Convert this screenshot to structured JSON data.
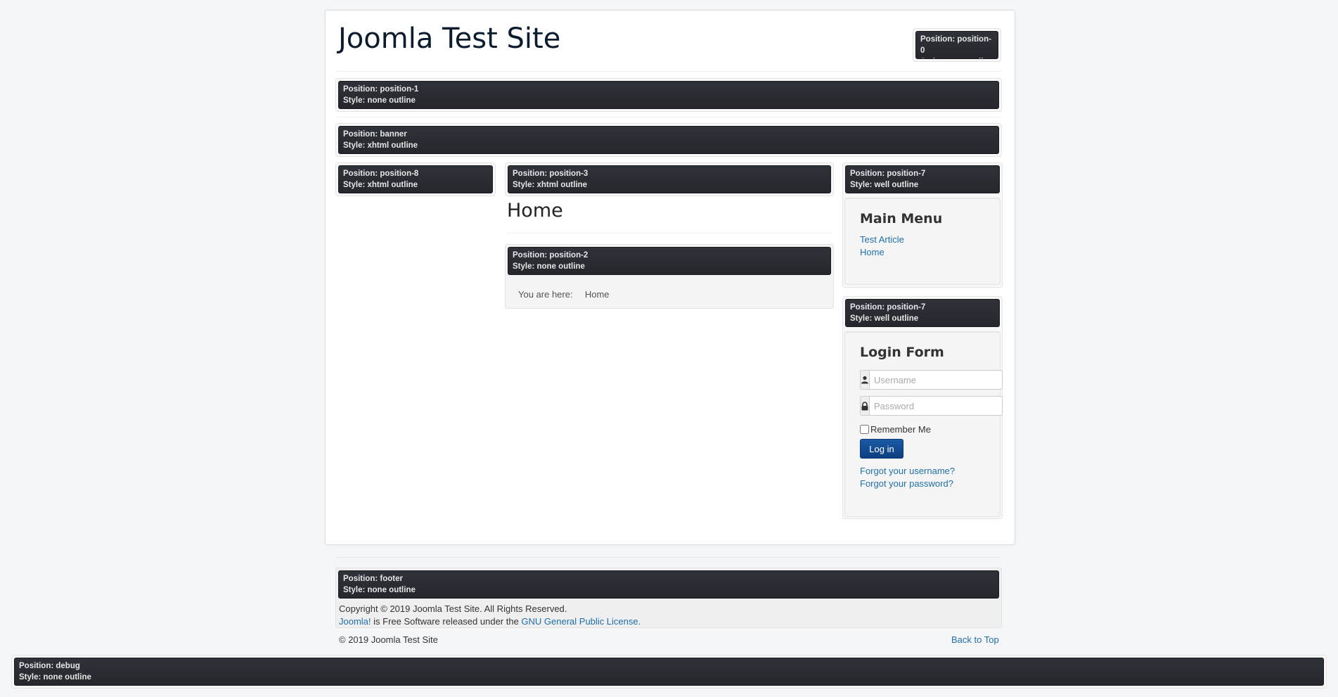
{
  "site": {
    "title": "Joomla Test Site"
  },
  "modules": {
    "position_0": {
      "position": "Position: position-0",
      "style": "Style: none outline"
    },
    "position_1": {
      "position": "Position: position-1",
      "style": "Style: none outline"
    },
    "banner": {
      "position": "Position: banner",
      "style": "Style: xhtml outline"
    },
    "position_8": {
      "position": "Position: position-8",
      "style": "Style: xhtml outline"
    },
    "position_3": {
      "position": "Position: position-3",
      "style": "Style: xhtml outline"
    },
    "position_2": {
      "position": "Position: position-2",
      "style": "Style: none outline"
    },
    "position_7a": {
      "position": "Position: position-7",
      "style": "Style: well outline"
    },
    "position_7b": {
      "position": "Position: position-7",
      "style": "Style: well outline"
    },
    "footer": {
      "position": "Position: footer",
      "style": "Style: none outline"
    },
    "debug": {
      "position": "Position: debug",
      "style": "Style: none outline"
    }
  },
  "main": {
    "page_heading": "Home",
    "breadcrumb": {
      "label": "You are here:",
      "current": "Home"
    }
  },
  "main_menu": {
    "title": "Main Menu",
    "items": [
      {
        "label": "Test Article"
      },
      {
        "label": "Home"
      }
    ]
  },
  "login_form": {
    "title": "Login Form",
    "username": {
      "placeholder": "Username",
      "value": ""
    },
    "password": {
      "placeholder": "Password",
      "value": ""
    },
    "remember_me": "Remember Me",
    "login_button": "Log in",
    "forgot_username": "Forgot your username?",
    "forgot_password": "Forgot your password?"
  },
  "footer": {
    "copyright": "Copyright © 2019 Joomla Test Site. All Rights Reserved.",
    "joomla_link": "Joomla!",
    "free_software_text": " is Free Software released under the ",
    "license_link": "GNU General Public License.",
    "bottom_copyright": "© 2019 Joomla Test Site",
    "back_to_top": "Back to Top"
  },
  "colors": {
    "link": "#1f6faa",
    "login_button": "#0d3f80",
    "position_bar": "#2a2c32",
    "background": "#f4f6f7"
  }
}
